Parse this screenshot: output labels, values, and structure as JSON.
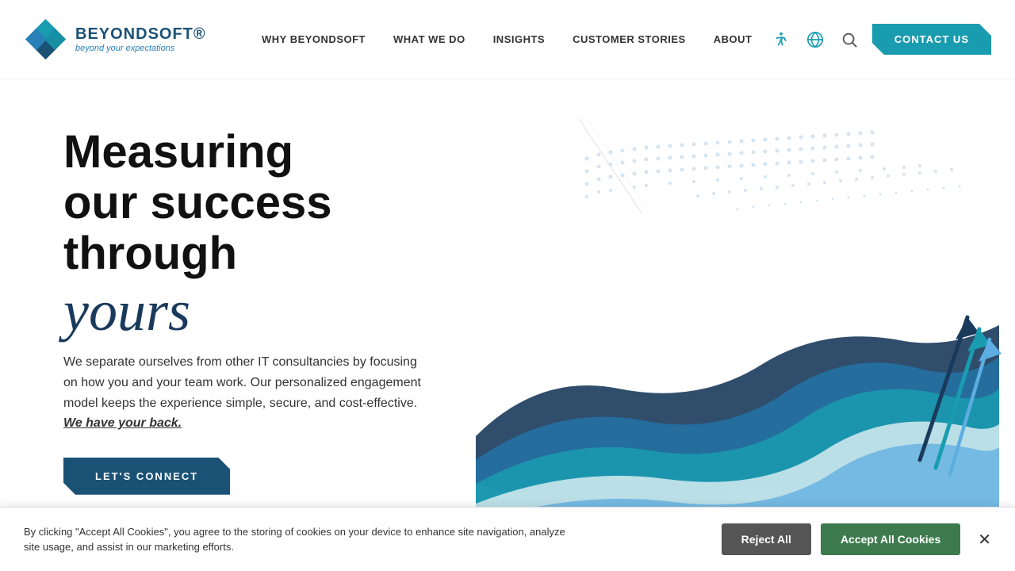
{
  "brand": {
    "name": "BEYONDSOFT®",
    "tagline": "beyond your expectations",
    "logo_aria": "Beyondsoft logo"
  },
  "nav": {
    "links": [
      {
        "label": "WHY BEYONDSOFT",
        "id": "why"
      },
      {
        "label": "WHAT WE DO",
        "id": "what"
      },
      {
        "label": "INSIGHTS",
        "id": "insights"
      },
      {
        "label": "CUSTOMER STORIES",
        "id": "stories"
      },
      {
        "label": "ABOUT",
        "id": "about"
      }
    ],
    "contact_label": "CONTACT US"
  },
  "hero": {
    "title_line1": "Measuring",
    "title_line2": "our success",
    "title_line3": "through",
    "title_script": "yours",
    "description": "We separate ourselves from other IT consultancies by focusing on how you and your team work. Our personalized engagement model keeps the experience simple, secure, and cost-effective.",
    "link_text": "We have your back.",
    "cta_label": "LET'S CONNECT"
  },
  "cookie": {
    "text": "By clicking \"Accept All Cookies\", you agree to the storing of cookies on your device to enhance site navigation, analyze site usage, and assist in our marketing efforts.",
    "reject_label": "Reject All",
    "accept_label": "Accept All Cookies"
  },
  "colors": {
    "primary_dark": "#1a5276",
    "primary_teal": "#1a9cb0",
    "green_accept": "#3d7a4e"
  }
}
